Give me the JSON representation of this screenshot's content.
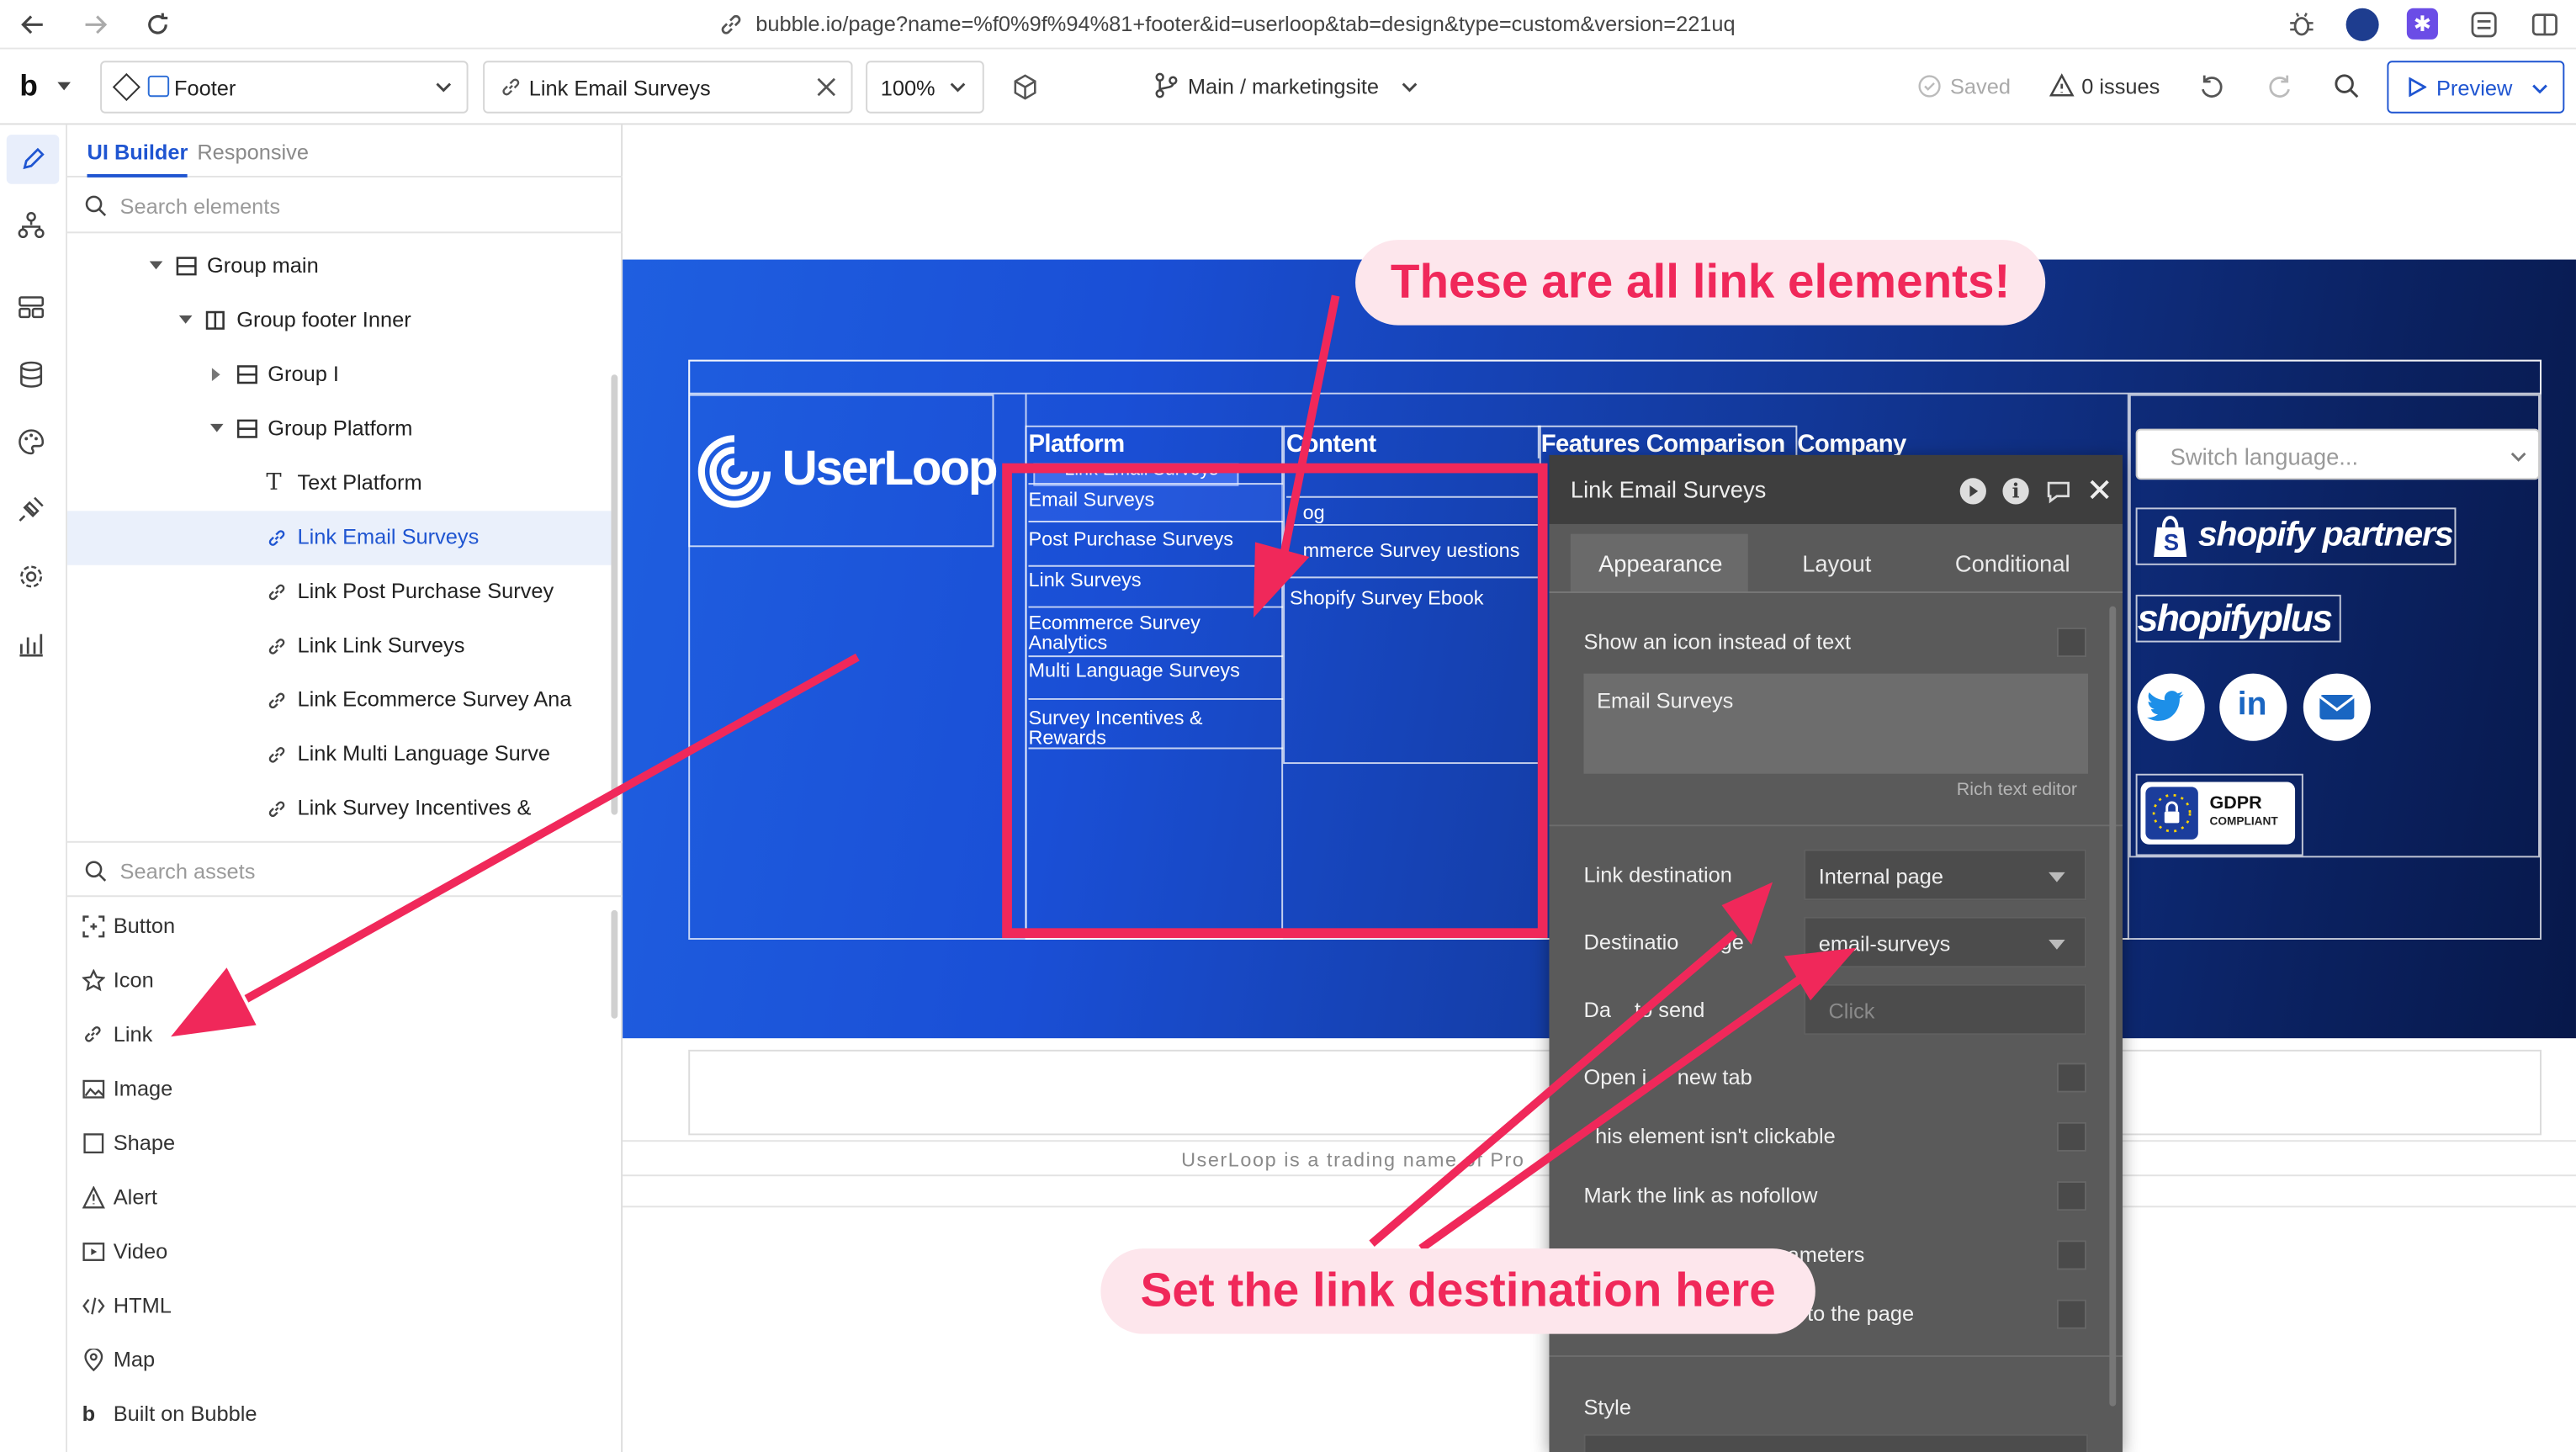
{
  "browser": {
    "url": "bubble.io/page?name=%f0%9f%94%81+footer&id=userloop&tab=design&type=custom&version=221uq"
  },
  "toolbar": {
    "logo": "b",
    "element_selector": "Footer",
    "selected_element": "Link Email Surveys",
    "zoom": "100%",
    "branch": "Main / marketingsite",
    "saved": "Saved",
    "issues": "0 issues",
    "preview": "Preview"
  },
  "panel": {
    "tabs": [
      "UI Builder",
      "Responsive"
    ],
    "search_elements_placeholder": "Search elements",
    "tree": [
      {
        "label": "Group main",
        "type": "group"
      },
      {
        "label": "Group footer Inner",
        "type": "columns"
      },
      {
        "label": "Group I",
        "type": "group"
      },
      {
        "label": "Group Platform",
        "type": "group"
      },
      {
        "label": "Text Platform",
        "type": "text"
      },
      {
        "label": "Link Email Surveys",
        "type": "link",
        "selected": true
      },
      {
        "label": "Link Post Purchase Survey",
        "type": "link"
      },
      {
        "label": "Link Link Surveys",
        "type": "link"
      },
      {
        "label": "Link Ecommerce Survey Ana",
        "type": "link"
      },
      {
        "label": "Link Multi Language Surve",
        "type": "link"
      },
      {
        "label": "Link Survey Incentives &",
        "type": "link"
      }
    ],
    "search_assets_placeholder": "Search assets",
    "assets": [
      "Button",
      "Icon",
      "Link",
      "Image",
      "Shape",
      "Alert",
      "Video",
      "HTML",
      "Map",
      "Built on Bubble"
    ]
  },
  "canvas": {
    "logo_text": "UserLoop",
    "columns": [
      {
        "heading": "Platform",
        "overlap_text": "Link Email Surveys",
        "links": [
          "Email Surveys",
          "Post Purchase Surveys",
          "Link Surveys",
          "Ecommerce Survey Analytics",
          "Multi Language Surveys",
          "Survey Incentives & Rewards"
        ]
      },
      {
        "heading": "Content",
        "links": [
          "og",
          "mmerce Survey uestions",
          "Shopify Survey Ebook"
        ]
      },
      {
        "heading": "Features Comparison",
        "links": []
      },
      {
        "heading": "Company",
        "links": []
      }
    ],
    "language_placeholder": "Switch language...",
    "shopify_partners": "shopify partners",
    "shopify_plus": "shopifyplus",
    "gdpr_title": "GDPR",
    "gdpr_sub": "COMPLIANT",
    "trading_name": "UserLoop is a trading name of Pro"
  },
  "editor": {
    "title": "Link Email Surveys",
    "tabs": [
      "Appearance",
      "Layout",
      "Conditional"
    ],
    "show_icon_label": "Show an icon instead of text",
    "text_value": "Email Surveys",
    "rich_text_editor": "Rich text editor",
    "link_destination_label": "Link destination",
    "link_destination_value": "Internal page",
    "destination_page_label": "Destinatio",
    "destination_page_label_tail": "ge",
    "destination_page_value": "email-surveys",
    "data_to_send_label": "Da",
    "data_to_send_label_tail": "to send",
    "data_to_send_placeholder": "Click",
    "open_new_tab": "Open i",
    "open_new_tab_tail": "new tab",
    "not_clickable": "his element isn't clickable",
    "nofollow": "Mark the link as nofollow",
    "parameters_tail": "ameters",
    "page_tail": "to the page",
    "style_label": "Style"
  },
  "annotations": {
    "top_callout": "These are all link elements!",
    "bottom_callout": "Set the link destination here",
    "color": "#f0285a"
  }
}
